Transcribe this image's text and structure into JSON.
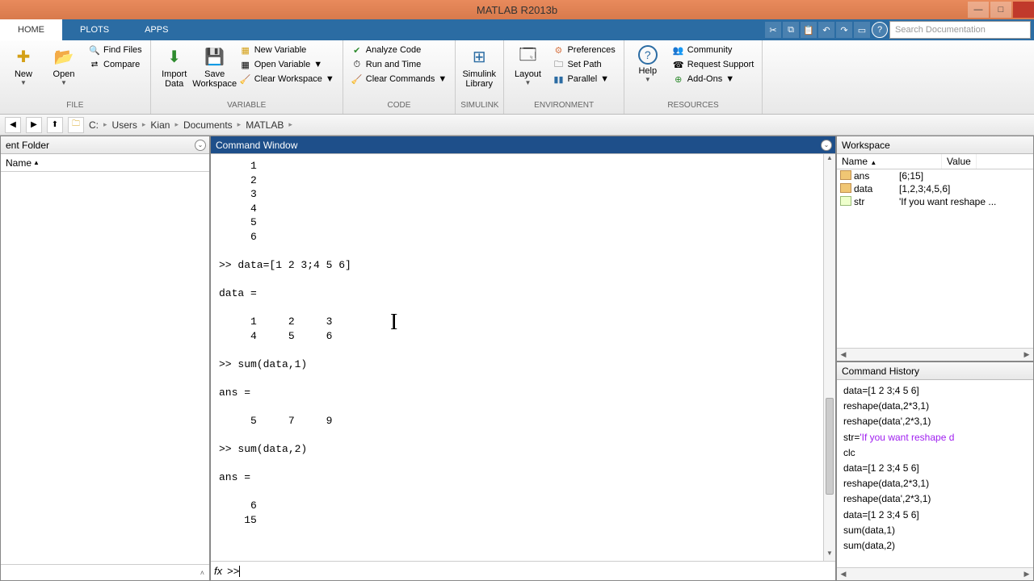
{
  "title": "MATLAB R2013b",
  "tabs": {
    "home": "HOME",
    "plots": "PLOTS",
    "apps": "APPS"
  },
  "search_placeholder": "Search Documentation",
  "ribbon": {
    "file": {
      "new": "New",
      "open": "Open",
      "find_files": "Find Files",
      "compare": "Compare",
      "label": "FILE"
    },
    "import": {
      "import": "Import\nData",
      "save": "Save\nWorkspace"
    },
    "variable": {
      "new_var": "New Variable",
      "open_var": "Open Variable",
      "clear_ws": "Clear Workspace",
      "label": "VARIABLE"
    },
    "code": {
      "analyze": "Analyze Code",
      "run_time": "Run and Time",
      "clear_cmd": "Clear Commands",
      "label": "CODE"
    },
    "simulink": {
      "lib": "Simulink\nLibrary",
      "label": "SIMULINK"
    },
    "env": {
      "layout": "Layout",
      "prefs": "Preferences",
      "set_path": "Set Path",
      "parallel": "Parallel",
      "label": "ENVIRONMENT"
    },
    "help": {
      "help": "Help"
    },
    "res": {
      "community": "Community",
      "support": "Request Support",
      "addons": "Add-Ons",
      "label": "RESOURCES"
    }
  },
  "breadcrumb": [
    "C:",
    "Users",
    "Kian",
    "Documents",
    "MATLAB"
  ],
  "panels": {
    "folder": "ent Folder",
    "folder_col": "Name",
    "cmd": "Command Window",
    "workspace": "Workspace",
    "ws_cols": {
      "name": "Name",
      "value": "Value"
    },
    "history": "Command History"
  },
  "cmd_output": "     1\n     2\n     3\n     4\n     5\n     6\n\n>> data=[1 2 3;4 5 6]\n\ndata =\n\n     1     2     3\n     4     5     6\n\n>> sum(data,1)\n\nans =\n\n     5     7     9\n\n>> sum(data,2)\n\nans =\n\n     6\n    15",
  "prompt_fx": "fx",
  "prompt": ">> ",
  "workspace_vars": [
    {
      "name": "ans",
      "value": "[6;15]",
      "type": "num"
    },
    {
      "name": "data",
      "value": "[1,2,3;4,5,6]",
      "type": "num"
    },
    {
      "name": "str",
      "value": "'If you want reshape ...",
      "type": "str"
    }
  ],
  "history": [
    {
      "t": "data=[1 2 3;4 5 6]"
    },
    {
      "t": "reshape(data,2*3,1)"
    },
    {
      "t": "reshape(data',2*3,1)"
    },
    {
      "t": "str='If you want reshape d",
      "s": true
    },
    {
      "t": "clc"
    },
    {
      "t": "data=[1 2 3;4 5 6]"
    },
    {
      "t": "reshape(data,2*3,1)"
    },
    {
      "t": "reshape(data',2*3,1)"
    },
    {
      "t": "data=[1 2 3;4 5 6]"
    },
    {
      "t": "sum(data,1)"
    },
    {
      "t": "sum(data,2)"
    }
  ]
}
